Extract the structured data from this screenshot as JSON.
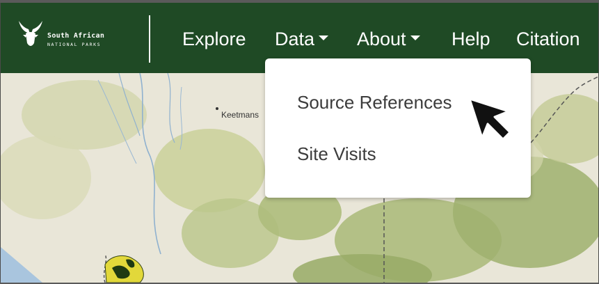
{
  "logo": {
    "line1": "South African",
    "line2": "NATIONAL PARKS",
    "icon": "kudu-head-icon"
  },
  "nav": {
    "explore": "Explore",
    "data": "Data",
    "about": "About",
    "help": "Help",
    "citation": "Citation"
  },
  "dropdown": {
    "items": [
      "Source References",
      "Site Visits"
    ]
  },
  "map": {
    "labels": [
      "Keetmans"
    ]
  },
  "colors": {
    "navbar": "#1f4a25",
    "map_base": "#e9e6d8",
    "map_green": "#b7c48c",
    "dropdown_bg": "#ffffff"
  }
}
